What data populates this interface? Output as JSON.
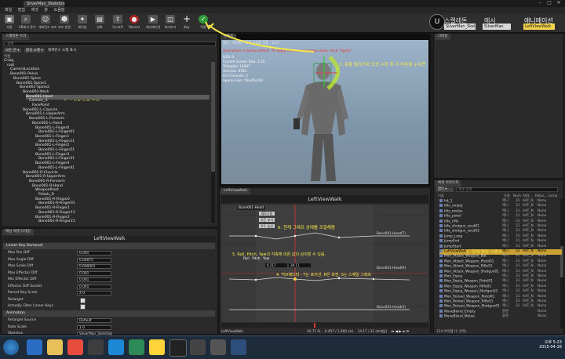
{
  "window": {
    "title": "SilverMan_Skeleton",
    "menu": [
      "파일",
      "편집",
      "에셋",
      "창",
      "도움말"
    ]
  },
  "toolbar": {
    "buttons": [
      {
        "label": "저장",
        "icon": "save-icon"
      },
      {
        "label": "CB에서 찾기",
        "icon": "find-icon"
      },
      {
        "label": "레퍼런스 포즈",
        "icon": "pose-icon"
      },
      {
        "label": "포즈 변경",
        "icon": "pose-icon"
      },
      {
        "label": "캐치업",
        "icon": "catch-icon"
      },
      {
        "label": "압축",
        "icon": "compress-icon"
      },
      {
        "label": "익스포트",
        "icon": "export-icon"
      },
      {
        "label": "Record",
        "icon": "record-icon"
      },
      {
        "label": "애니메이션",
        "icon": "anim-icon"
      },
      {
        "label": "미리보기",
        "icon": "preview-icon"
      },
      {
        "label": "Key",
        "icon": "plus-icon"
      },
      {
        "label": "적용",
        "icon": "apply-icon"
      }
    ],
    "modes": {
      "skeleton": "스켈레톤",
      "mesh": "메시",
      "animation": "애니메이션"
    },
    "mode_values": {
      "skeleton": "SilverMan_Skel",
      "mesh": "SilverMan",
      "animation": "LeftViewWalk"
    }
  },
  "skeleton_tree": {
    "tab": "스켈레톤 트리",
    "search_placeholder": "검색",
    "filters": [
      "모든 본 ▾",
      "활성 소켓 ▾",
      "레퍼런스 소켓 표시"
    ],
    "header": "이름",
    "items": [
      {
        "name": "Craig",
        "indent": 0
      },
      {
        "name": "root",
        "indent": 1
      },
      {
        "name": "CameraLocation",
        "indent": 2
      },
      {
        "name": "Bone001-Pelvis",
        "indent": 2
      },
      {
        "name": "Bone001-Spine",
        "indent": 3
      },
      {
        "name": "Bone001-Spine1",
        "indent": 4
      },
      {
        "name": "Bone001-Spine2",
        "indent": 5
      },
      {
        "name": "Bone001-Neck",
        "indent": 6
      },
      {
        "name": "Bone001-Head",
        "indent": 7,
        "selected": true
      },
      {
        "name": "CamLoc_3",
        "indent": 8
      },
      {
        "name": "FacePoint",
        "indent": 9
      },
      {
        "name": "Bone001-L-Clavicle",
        "indent": 6
      },
      {
        "name": "Bone001-L-UpperArm",
        "indent": 7
      },
      {
        "name": "Bone001-L-Forearm",
        "indent": 8
      },
      {
        "name": "Bone001-L-Hand",
        "indent": 9
      },
      {
        "name": "Bone001-L-Finger0",
        "indent": 10
      },
      {
        "name": "Bone001-L-Finger01",
        "indent": 11
      },
      {
        "name": "Bone001-L-Finger1",
        "indent": 10
      },
      {
        "name": "Bone001-L-Finger11",
        "indent": 11
      },
      {
        "name": "Bone001-L-Finger2",
        "indent": 10
      },
      {
        "name": "Bone001-L-Finger21",
        "indent": 11
      },
      {
        "name": "Bone001-L-Finger3",
        "indent": 10
      },
      {
        "name": "Bone001-L-Finger31",
        "indent": 11
      },
      {
        "name": "Bone001-L-Finger4",
        "indent": 10
      },
      {
        "name": "Bone001-L-Finger41",
        "indent": 11
      },
      {
        "name": "Bone001-R-Clavicle",
        "indent": 6
      },
      {
        "name": "Bone001-R-UpperArm",
        "indent": 7
      },
      {
        "name": "Bone001-R-Forearm",
        "indent": 8
      },
      {
        "name": "Bone001-R-Hand",
        "indent": 9
      },
      {
        "name": "WeaponPoint",
        "indent": 10
      },
      {
        "name": "Pistols_R",
        "indent": 11
      },
      {
        "name": "Bone001-R-Finger0",
        "indent": 10
      },
      {
        "name": "Bone001-R-Finger01",
        "indent": 11
      },
      {
        "name": "Bone001-R-Finger1",
        "indent": 10
      },
      {
        "name": "Bone001-R-Finger11",
        "indent": 11
      },
      {
        "name": "Bone001-R-Finger2",
        "indent": 10
      },
      {
        "name": "Bone001-R-Finger21",
        "indent": 11
      }
    ]
  },
  "details": {
    "tab": "애님 에셋 디테일",
    "title": "LeftViewWalk",
    "sections": {
      "key_removal": "Linear Key Removal",
      "animation": "Animation"
    },
    "rows": [
      {
        "label": "Max Pos Diff",
        "value": "0.001"
      },
      {
        "label": "Max Angle Diff",
        "value": "0.00075"
      },
      {
        "label": "Max Scale Diff",
        "value": "0.000001"
      },
      {
        "label": "Max Effector Diff",
        "value": "0.001"
      },
      {
        "label": "Min Effector Diff",
        "value": "0.001"
      },
      {
        "label": "Effector Diff Socket",
        "value": "0.001"
      },
      {
        "label": "Parent Key Scale",
        "value": "2.0"
      },
      {
        "label": "Retarget",
        "value": ""
      },
      {
        "label": "Actually Filter Linear Keys",
        "value": ""
      }
    ],
    "anim_rows": [
      {
        "label": "Retarget Source",
        "value": "Default"
      },
      {
        "label": "Rate Scale",
        "value": "1.0"
      },
      {
        "label": "Skeleton",
        "value": "SilverMan_Skeleton"
      }
    ]
  },
  "viewport": {
    "tab": "뷰포트",
    "toolbar": [
      "원근",
      "라이팅",
      "표시",
      "LOD 자동",
      "x1.0"
    ],
    "warning": "Animation is being edited. To apply to raw animation data, click \"Apply\"",
    "stats": [
      "LOD: 0",
      "Current Screen Size: 1.05",
      "Triangles: 14847",
      "Vertices: 9783",
      "UV Channels: 2",
      "Approx Size: 59x45x204"
    ],
    "annotation": "3. 축을 돌려가며 모션 수정 후 키 버튼을 누르면"
  },
  "anim_editor": {
    "tab": "LeftViewWalk",
    "title": "LeftViewWalk",
    "bone_label": "Bone001-Head",
    "graph_buttons": [
      "새로고침",
      "모든 보기",
      "모두 숨김"
    ],
    "channels": [
      "Bone001-Head(T)",
      "Bone001-Head(R)",
      "Bone001-Head(S)"
    ],
    "roll_pitch_yaw": {
      "roll": "Roll",
      "pitch": "Pitch",
      "yaw": "Yaw"
    },
    "axis_values": {
      "x": "0.217",
      "y": "39.11"
    },
    "annotations": {
      "graph": "6. 현재 그래프 상태를 조절해줌",
      "rpy": "5. Roll, Pitch, Yaw의 각축에 따른 값이 상이할 수 있음.",
      "curve": "4. 커브에디터 - T는 포지션, R은 회전, S는 스케일 그래프"
    },
    "status": {
      "name": "LeftViewWalk",
      "percent": "45.71 %",
      "time": "0.457 / 1.000 (초)",
      "frame": "14.17 / 31 (프레임)"
    }
  },
  "annotation_bone": "2. 수정할 본을 고름",
  "annotation_asset": "1. 현재 편집 시퀀스",
  "anim_browser": {
    "tab": "애셋 브라우저",
    "search_placeholder": "애셋 검색",
    "filter": "필터 ▾",
    "headers": {
      "name": "이름",
      "type": "유형",
      "num": "Num",
      "add": "Add...",
      "retarget": "Retar...",
      "comp": "Comp"
    },
    "items": [
      {
        "name": "hit_1",
        "type": "애니",
        "num": "31",
        "add": "AAT_N",
        "ret": "None"
      },
      {
        "name": "Idle_empty",
        "type": "애니",
        "num": "31",
        "add": "AAT_N",
        "ret": "None"
      },
      {
        "name": "Idle_melee",
        "type": "애니",
        "num": "31",
        "add": "AAT_N",
        "ret": "None"
      },
      {
        "name": "Idle_pistol",
        "type": "애니",
        "num": "31",
        "add": "AAT_N",
        "ret": "None"
      },
      {
        "name": "Idle_rifle",
        "type": "애니",
        "num": "31",
        "add": "AAT_N",
        "ret": "None"
      },
      {
        "name": "Idle_shotgun_socd01",
        "type": "애니",
        "num": "31",
        "add": "AAT_N",
        "ret": "None"
      },
      {
        "name": "Idle_shotgun_socd02",
        "type": "애니",
        "num": "31",
        "add": "AAT_N",
        "ret": "None"
      },
      {
        "name": "Jump_Loop",
        "type": "애니",
        "num": "31",
        "add": "AAT_N",
        "ret": "None"
      },
      {
        "name": "JumpEnd",
        "type": "애니",
        "num": "31",
        "add": "AAT_N",
        "ret": "None"
      },
      {
        "name": "JumpStart",
        "type": "애니",
        "num": "31",
        "add": "AAT_N",
        "ret": "None"
      },
      {
        "name": "LeftViewWalk",
        "type": "애니",
        "num": "31",
        "add": "AAT_N",
        "ret": "None",
        "selected": true
      },
      {
        "name": "Mon_Attack_Weapon_Bat",
        "type": "애니",
        "num": "31",
        "add": "AAT_N",
        "ret": "None"
      },
      {
        "name": "Mon_Attack_Weapon_Pistol01",
        "type": "애니",
        "num": "31",
        "add": "AAT_N",
        "ret": "None"
      },
      {
        "name": "Mon_Attack_Weapon_Rifle01",
        "type": "애니",
        "num": "31",
        "add": "AAT_N",
        "ret": "None"
      },
      {
        "name": "Mon_Attack_Weapon_Shotgun01",
        "type": "애니",
        "num": "31",
        "add": "AAT_N",
        "ret": "None"
      },
      {
        "name": "Mon_Equip",
        "type": "애니",
        "num": "31",
        "add": "AAT_N",
        "ret": "None"
      },
      {
        "name": "Mon_Equip_Weapon_Pistol01",
        "type": "애니",
        "num": "31",
        "add": "AAT_N",
        "ret": "None"
      },
      {
        "name": "Mon_Equip_Weapon_Rifle01",
        "type": "애니",
        "num": "31",
        "add": "AAT_N",
        "ret": "None"
      },
      {
        "name": "Mon_Equip_Weapon_Shotgun01",
        "type": "애니",
        "num": "31",
        "add": "AAT_N",
        "ret": "None"
      },
      {
        "name": "Mon_Reload_Weapon_Pistol01",
        "type": "애니",
        "num": "31",
        "add": "AAT_N",
        "ret": "None"
      },
      {
        "name": "Mon_Reload_Weapon_Rifle01",
        "type": "애니",
        "num": "31",
        "add": "AAT_N",
        "ret": "None"
      },
      {
        "name": "Mon_Reload_Weapon_Shotgun01",
        "type": "애니",
        "num": "31",
        "add": "AAT_N",
        "ret": "None"
      },
      {
        "name": "MoveBlend_Empty",
        "type": "블렌",
        "num": "",
        "add": "",
        "ret": "None"
      },
      {
        "name": "MoveBlend_Melee",
        "type": "블렌",
        "num": "",
        "add": "",
        "ret": "None"
      }
    ],
    "count": "124 아이템 (1 선택)"
  },
  "taskbar": {
    "time": "오후 5:23",
    "date": "2015-04-26"
  },
  "colors": {
    "selected_bone": "#5c5c5c",
    "annotation": "#f7e84a",
    "selected_anim": "#c9a032",
    "viewport_sky": "#8fa7bf"
  }
}
